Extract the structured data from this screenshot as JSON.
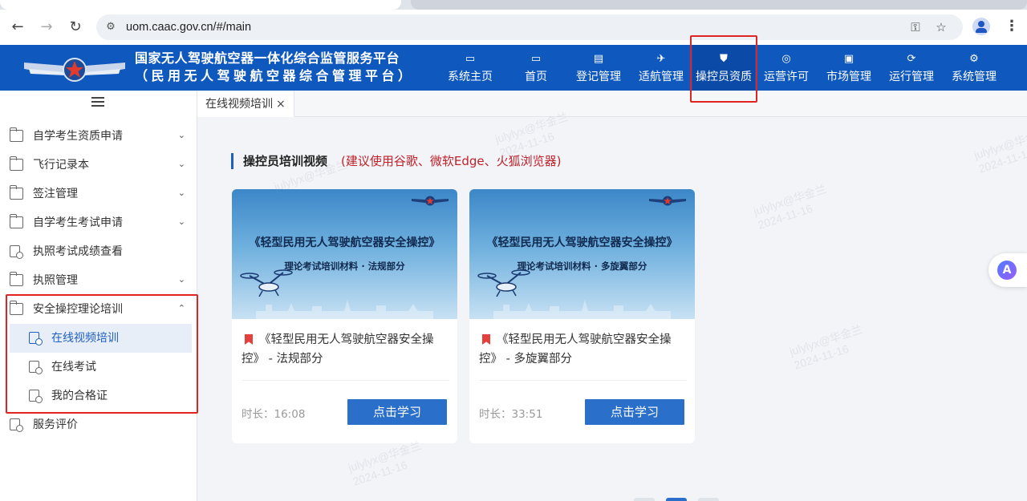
{
  "browser": {
    "url": "uom.caac.gov.cn/#/main"
  },
  "header": {
    "title": "国家无人驾驶航空器一体化综合监管服务平台",
    "subtitle": "（民用无人驾驶航空器综合管理平台）",
    "nav": [
      {
        "label": "系统主页",
        "icon": "home-screen-icon"
      },
      {
        "label": "首页",
        "icon": "monitor-icon"
      },
      {
        "label": "登记管理",
        "icon": "register-doc-icon"
      },
      {
        "label": "适航管理",
        "icon": "drone-icon"
      },
      {
        "label": "操控员资质",
        "icon": "shield-icon"
      },
      {
        "label": "运营许可",
        "icon": "target-icon"
      },
      {
        "label": "市场管理",
        "icon": "market-icon"
      },
      {
        "label": "运行管理",
        "icon": "cycle-icon"
      },
      {
        "label": "系统管理",
        "icon": "network-icon"
      }
    ],
    "active_nav": "操控员资质"
  },
  "sidebar": {
    "items": [
      {
        "label": "自学考生资质申请"
      },
      {
        "label": "飞行记录本"
      },
      {
        "label": "签注管理"
      },
      {
        "label": "自学考生考试申请"
      },
      {
        "label": "执照考试成绩查看"
      },
      {
        "label": "执照管理"
      },
      {
        "label": "安全操控理论培训"
      },
      {
        "label": "服务评价"
      }
    ],
    "subitems": [
      {
        "label": "在线视频培训"
      },
      {
        "label": "在线考试"
      },
      {
        "label": "我的合格证"
      }
    ]
  },
  "tabs": [
    {
      "label": "在线视频培训",
      "close": "×"
    }
  ],
  "main": {
    "section_title": "操控员培训视频",
    "section_note": "(建议使用谷歌、微软Edge、火狐浏览器)",
    "cards": [
      {
        "thumb_title": "《轻型民用无人驾驶航空器安全操控》",
        "thumb_subtitle": "理论考试培训材料 · 法规部分",
        "title": "《轻型民用无人驾驶航空器安全操控》 - 法规部分",
        "duration_label": "时长：",
        "duration": "16:08",
        "button": "点击学习"
      },
      {
        "thumb_title": "《轻型民用无人驾驶航空器安全操控》",
        "thumb_subtitle": "理论考试培训材料 · 多旋翼部分",
        "title": "《轻型民用无人驾驶航空器安全操控》 - 多旋翼部分",
        "duration_label": "时长：",
        "duration": "33:51",
        "button": "点击学习"
      }
    ]
  },
  "watermark": {
    "line1": "julylyx@华金兰",
    "line2": "2024-11-16"
  },
  "colors": {
    "header_bg": "#0f58be",
    "accent": "#1f5fbf",
    "highlight": "#e02424",
    "note": "#c0212b",
    "button": "#2a6fc9"
  }
}
